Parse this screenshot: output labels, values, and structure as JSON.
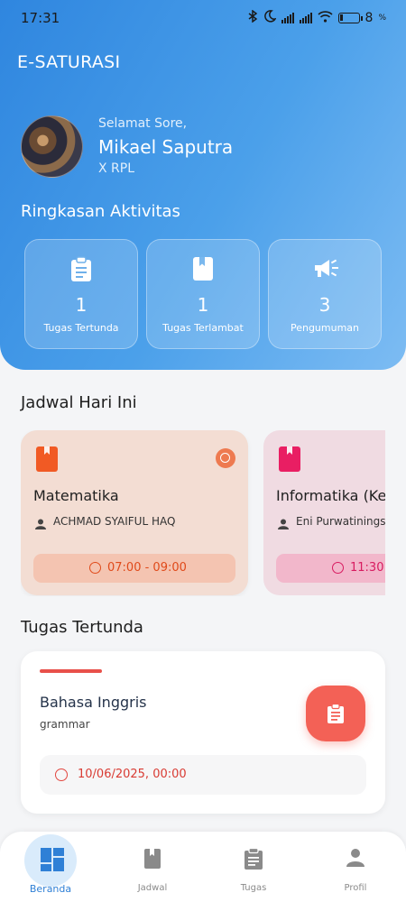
{
  "status_bar": {
    "time": "17:31",
    "battery": "8"
  },
  "app_bar": {
    "title": "E-SATURASI"
  },
  "profile": {
    "greeting": "Selamat Sore,",
    "name": "Mikael Saputra",
    "class": "X RPL"
  },
  "summary": {
    "title": "Ringkasan Aktivitas",
    "cards": [
      {
        "value": "1",
        "label": "Tugas Tertunda",
        "icon": "clipboard-icon"
      },
      {
        "value": "1",
        "label": "Tugas Terlambat",
        "icon": "book-icon"
      },
      {
        "value": "3",
        "label": "Pengumuman",
        "icon": "megaphone-icon"
      }
    ]
  },
  "schedule": {
    "title": "Jadwal Hari Ini",
    "items": [
      {
        "subject": "Matematika",
        "teacher": "ACHMAD SYAIFUL HAQ",
        "time": "07:00 - 09:00",
        "color": "#f15a24",
        "bg": "#f3ddd3",
        "bar": "#f4c4b1",
        "text": "#e04a1a"
      },
      {
        "subject": "Informatika (Kela",
        "teacher": "Eni Purwatinings",
        "time": "11:30",
        "color": "#e91e63",
        "bg": "#f0dbe2",
        "bar": "#f2b7cb",
        "text": "#d81b60"
      }
    ]
  },
  "pending": {
    "title": "Tugas Tertunda",
    "task": {
      "subject": "Bahasa Inggris",
      "description": "grammar",
      "due": "10/06/2025, 00:00"
    }
  },
  "nav": [
    {
      "label": "Beranda",
      "icon": "dashboard-icon",
      "active": true
    },
    {
      "label": "Jadwal",
      "icon": "book-icon",
      "active": false
    },
    {
      "label": "Tugas",
      "icon": "clipboard-icon",
      "active": false
    },
    {
      "label": "Profil",
      "icon": "person-icon",
      "active": false
    }
  ]
}
